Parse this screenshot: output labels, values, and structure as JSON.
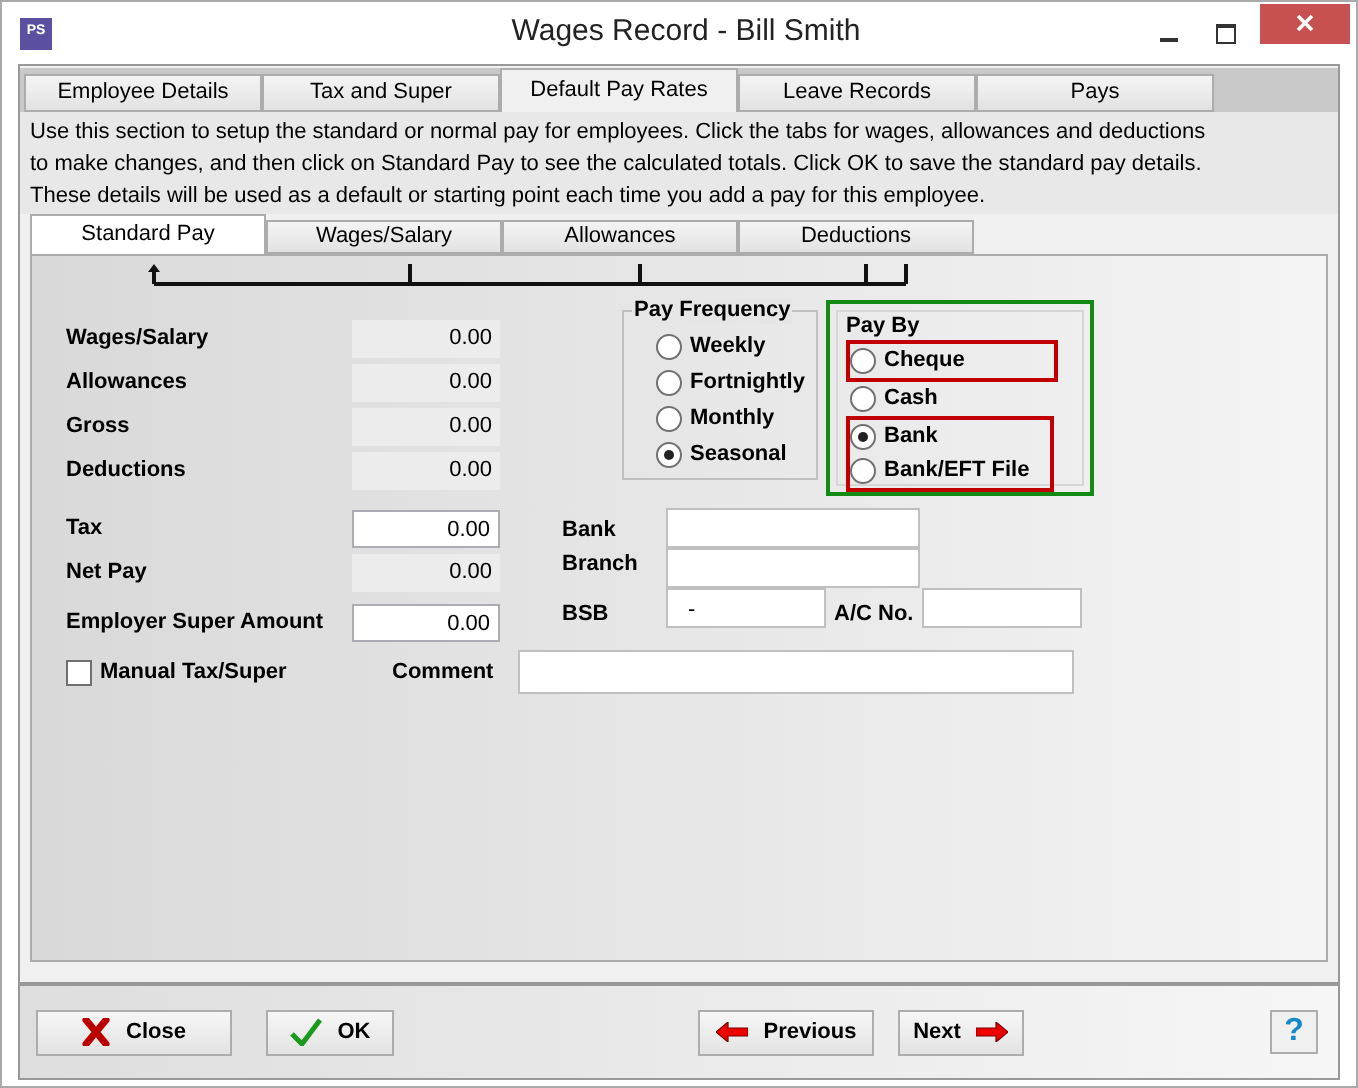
{
  "window": {
    "title": "Wages Record - Bill Smith",
    "app_icon": "PS"
  },
  "tabs": [
    {
      "label": "Employee Details",
      "selected": false
    },
    {
      "label": "Tax and Super",
      "selected": false
    },
    {
      "label": "Default Pay Rates",
      "selected": true
    },
    {
      "label": "Leave Records",
      "selected": false
    },
    {
      "label": "Pays",
      "selected": false
    }
  ],
  "intro": [
    "Use this section to setup the standard or normal pay for employees. Click the tabs for wages, allowances and deductions to make changes, and then click on Standard Pay to see the calculated totals. Click OK to save the standard pay details.",
    "These details will be used as a default or starting point each time you add a pay for this employee."
  ],
  "sub_tabs": [
    {
      "label": "Standard Pay",
      "selected": true
    },
    {
      "label": "Wages/Salary",
      "selected": false
    },
    {
      "label": "Allowances",
      "selected": false
    },
    {
      "label": "Deductions",
      "selected": false
    }
  ],
  "totals": [
    {
      "label": "Wages/Salary",
      "value": "0.00",
      "editable": false
    },
    {
      "label": "Allowances",
      "value": "0.00",
      "editable": false
    },
    {
      "label": "Gross",
      "value": "0.00",
      "editable": false
    },
    {
      "label": "Deductions",
      "value": "0.00",
      "editable": false
    }
  ],
  "amounts": [
    {
      "label": "Tax",
      "value": "0.00",
      "editable": true
    },
    {
      "label": "Net Pay",
      "value": "0.00",
      "editable": false
    },
    {
      "label": "Employer Super Amount",
      "value": "0.00",
      "editable": true
    }
  ],
  "manual_tax_super": {
    "label": "Manual Tax/Super",
    "checked": false
  },
  "pay_frequency": {
    "title": "Pay Frequency",
    "options": [
      {
        "label": "Weekly",
        "selected": false
      },
      {
        "label": "Fortnightly",
        "selected": false
      },
      {
        "label": "Monthly",
        "selected": false
      },
      {
        "label": "Seasonal",
        "selected": true
      }
    ]
  },
  "pay_by": {
    "title": "Pay By",
    "options": [
      {
        "label": "Cheque",
        "selected": false
      },
      {
        "label": "Cash",
        "selected": false
      },
      {
        "label": "Bank",
        "selected": true
      },
      {
        "label": "Bank/EFT File",
        "selected": false
      }
    ]
  },
  "bank": {
    "bank_label": "Bank",
    "branch_label": "Branch",
    "bsb_label": "BSB",
    "bsb_value": "-",
    "account_label": "A/C No.",
    "comment_label": "Comment"
  },
  "buttons": [
    {
      "label": "Close",
      "kind": "close"
    },
    {
      "label": "OK",
      "kind": "ok"
    },
    {
      "label": "Previous",
      "kind": "previous"
    },
    {
      "label": "Next",
      "kind": "next"
    },
    {
      "label": "?",
      "kind": "help"
    }
  ]
}
